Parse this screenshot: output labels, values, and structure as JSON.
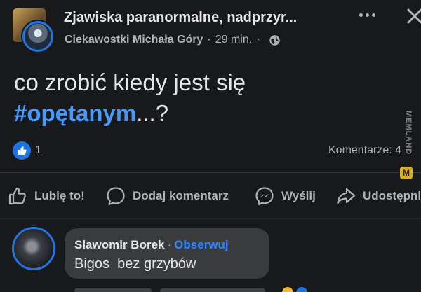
{
  "post": {
    "group_name": "Zjawiska paranormalne, nadprzyr...",
    "author": "Ciekawostki Michała Góry",
    "separator": "·",
    "time_ago": "29 min.",
    "text_line1": "co zrobić kiedy jest się",
    "hashtag": "#opętanym",
    "text_suffix": "...?",
    "like_count": "1",
    "comments_label": "Komentarze: 4"
  },
  "actions": {
    "like": "Lubię to!",
    "comment": "Dodaj komentarz",
    "send": "Wyślij",
    "share": "Udostępnij"
  },
  "comment": {
    "author": "Slawomir Borek",
    "separator": "·",
    "follow": "Obserwuj",
    "text": "Bigos  bez grzybów"
  },
  "watermark": {
    "text": "MEMLAND",
    "badge": "M"
  },
  "icons": {
    "more": "more-horizontal-icon",
    "close": "close-icon",
    "privacy": "globe-icon",
    "like_badge": "thumbs-up-icon",
    "like": "thumbs-up-outline-icon",
    "comment": "speech-bubble-icon",
    "send": "messenger-icon",
    "share": "share-arrow-icon"
  },
  "colors": {
    "background": "#18191a",
    "text": "#e4e6eb",
    "secondary_text": "#b0b3b8",
    "accent_blue": "#2d88ff",
    "hashtag_blue": "#4599ff",
    "like_badge": "#1b74e4"
  }
}
